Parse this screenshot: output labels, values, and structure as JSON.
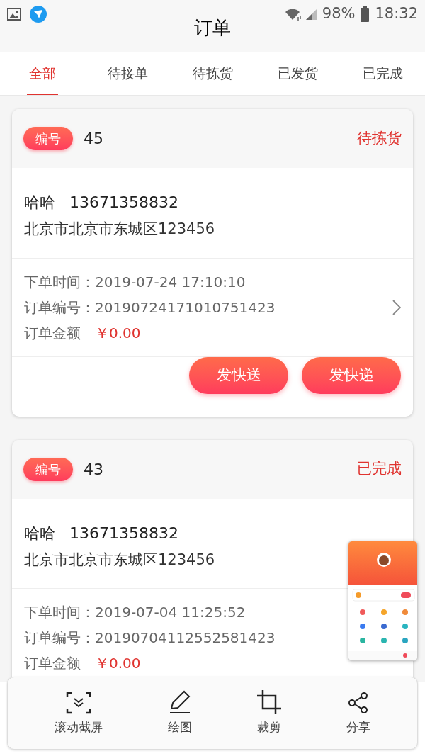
{
  "status_bar": {
    "battery": "98%",
    "time": "18:32"
  },
  "header": {
    "title": "订单"
  },
  "tabs": [
    {
      "label": "全部",
      "selected": true
    },
    {
      "label": "待接单",
      "selected": false
    },
    {
      "label": "待拣货",
      "selected": false
    },
    {
      "label": "已发货",
      "selected": false
    },
    {
      "label": "已完成",
      "selected": false
    }
  ],
  "orders": [
    {
      "badge": "编号",
      "number": "45",
      "status": "待拣货",
      "name": "哈哈",
      "phone": "13671358832",
      "address": "北京市北京市东城区123456",
      "details": [
        {
          "label": "下单时间：",
          "value": "2019-07-24 17:10:10",
          "kind": "plain"
        },
        {
          "label": "订单编号：",
          "value": "20190724171010751423",
          "kind": "plain"
        },
        {
          "label": "订单金额",
          "value": "￥0.00",
          "kind": "price"
        }
      ],
      "actions": [
        "发快送",
        "发快递"
      ]
    },
    {
      "badge": "编号",
      "number": "43",
      "status": "已完成",
      "name": "哈哈",
      "phone": "13671358832",
      "address": "北京市北京市东城区123456",
      "details": [
        {
          "label": "下单时间：",
          "value": "2019-07-04 11:25:52",
          "kind": "plain"
        },
        {
          "label": "订单编号：",
          "value": "20190704112552581423",
          "kind": "plain"
        },
        {
          "label": "订单金额",
          "value": "￥0.00",
          "kind": "price"
        }
      ]
    }
  ],
  "screenshot_toolbar": [
    {
      "label": "滚动截屏",
      "kind": "scroll"
    },
    {
      "label": "绘图",
      "kind": "draw"
    },
    {
      "label": "裁剪",
      "kind": "crop"
    },
    {
      "label": "分享",
      "kind": "share"
    }
  ]
}
